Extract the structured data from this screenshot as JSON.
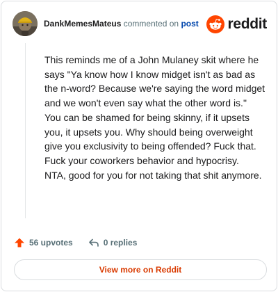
{
  "header": {
    "username": "DankMemesMateus",
    "verb": "commented on",
    "post_link": "post",
    "logo_text": "reddit"
  },
  "comment": {
    "paragraphs": [
      "This reminds me of a John Mulaney skit where he says \"Ya know how I know midget isn't as bad as the n-word? Because we're saying the word midget and we won't even say what the other word is.\"",
      "You can be shamed for being skinny, if it upsets you, it upsets you. Why should being overweight give you exclusivity to being offended? Fuck that. Fuck your coworkers behavior and hypocrisy.",
      "NTA, good for you for not taking that shit anymore."
    ]
  },
  "actions": {
    "upvotes": "56 upvotes",
    "replies": "0 replies"
  },
  "footer": {
    "view_more": "View more on Reddit"
  },
  "colors": {
    "brand": "#ff4500",
    "link": "#0045ac",
    "view_more": "#d93a00",
    "muted": "#576f76"
  },
  "icons": {
    "logo": "reddit-alien-icon",
    "upvote": "upvote-arrow-icon",
    "reply": "reply-arrow-icon"
  }
}
